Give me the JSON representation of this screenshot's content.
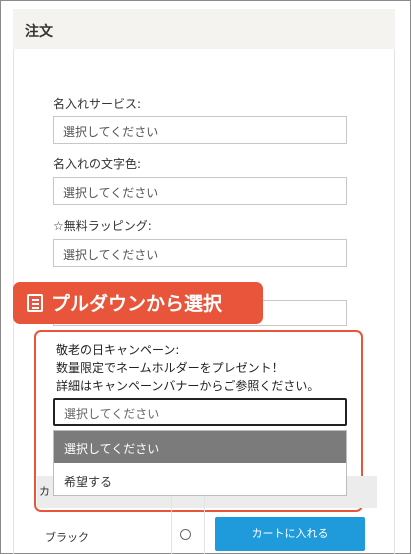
{
  "panel": {
    "title": "注文"
  },
  "fields": [
    {
      "label": "名入れサービス:",
      "placeholder": "選択してください"
    },
    {
      "label": "名入れの文字色:",
      "placeholder": "選択してください"
    },
    {
      "label": "☆無料ラッピング:",
      "placeholder": "選択してください"
    },
    {
      "label": "",
      "placeholder": ""
    }
  ],
  "callout": {
    "icon": "list-icon",
    "text": "プルダウンから選択",
    "color": "#e9553a"
  },
  "campaign": {
    "line1": "敬老の日キャンペーン:",
    "line2": "数量限定でネームホルダーをプレゼント！",
    "line3": "詳細はキャンペーンバナーからご参照ください。",
    "select_value": "選択してください",
    "options": [
      "選択してください",
      "希望する"
    ]
  },
  "table": {
    "header_cut": "カ",
    "row": {
      "name": "ブラック",
      "button": "カートに入れる"
    }
  },
  "colors": {
    "accent": "#e9553a",
    "button": "#1f9bdb",
    "header_bg": "#f4f3ef"
  }
}
